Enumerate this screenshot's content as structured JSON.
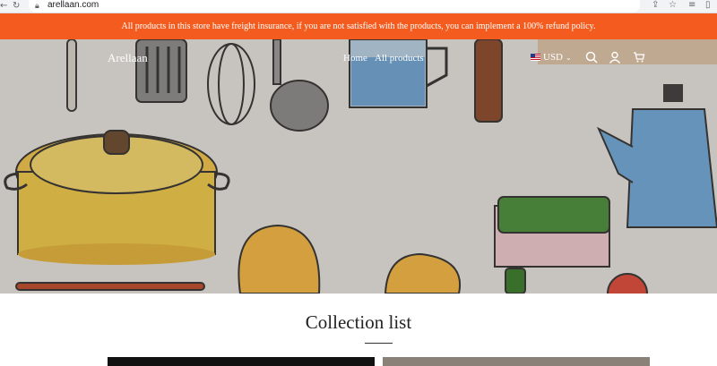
{
  "browser": {
    "url": "arellaan.com",
    "back_icon": "back-arrow-icon",
    "reload_icon": "reload-icon",
    "lock_icon": "lock-icon",
    "toolbar_icons": [
      "share-icon",
      "star-icon",
      "reading-list-icon",
      "sidebar-icon"
    ]
  },
  "announcement": {
    "text": "All products in this store have freight insurance, if you are not satisfied with the products, you can implement a 100% refund policy.",
    "background": "#f45c1f"
  },
  "header": {
    "logo": "Arellaan",
    "nav": [
      {
        "label": "Home"
      },
      {
        "label": "All products"
      }
    ],
    "currency": "USD",
    "icons": [
      "search-icon",
      "account-icon",
      "cart-icon"
    ]
  },
  "collection": {
    "title": "Collection list"
  }
}
